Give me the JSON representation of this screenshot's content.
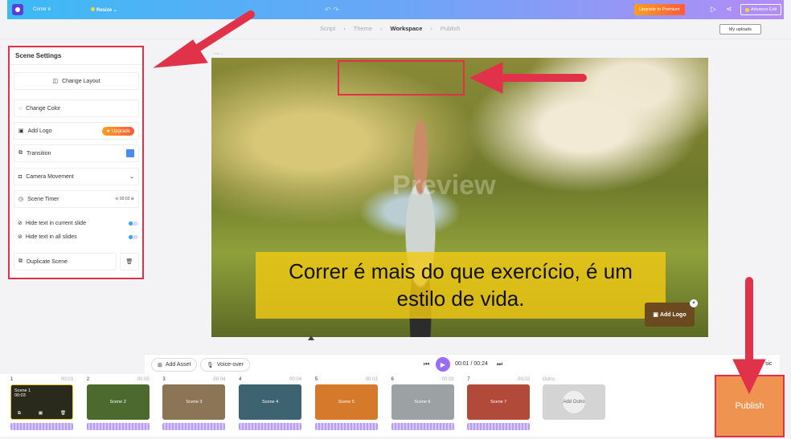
{
  "topbar": {
    "project_title": "Correr é",
    "resize": "Resize",
    "upgrade": "Upgrade to Premium",
    "advance_edit": "Advance Edit"
  },
  "steps": [
    "Script",
    "Theme",
    "Workspace",
    "Publish"
  ],
  "my_uploads": "My uploads",
  "scene_settings": {
    "title": "Scene Settings",
    "change_layout": "Change Layout",
    "change_color": "Change Color",
    "add_logo": "Add Logo",
    "upgrade_badge": "Upgrade",
    "transition": "Transition",
    "camera_movement": "Camera Movement",
    "scene_timer": "Scene Timer",
    "timer_value": "00:03",
    "hide_current": "Hide text in current slide",
    "hide_all": "Hide text in all slides",
    "duplicate": "Duplicate Scene"
  },
  "canvas": {
    "slide_label": "Slide 1",
    "watermark": "Preview",
    "caption": "Correr é mais do que exercício, é um estilo de vida.",
    "add_logo": "Add Logo"
  },
  "controls": {
    "add_asset": "Add Asset",
    "voice_over": "Voice-over",
    "time": "00:01 / 00:24",
    "music": "sic"
  },
  "scenes": [
    {
      "num": "1",
      "dur": "00:03",
      "label": "Scene 1",
      "color": "#2a2a1c"
    },
    {
      "num": "2",
      "dur": "00:05",
      "label": "Scene 2",
      "color": "#4d6a2e"
    },
    {
      "num": "3",
      "dur": "00:04",
      "label": "Scene 3",
      "color": "#8c7556"
    },
    {
      "num": "4",
      "dur": "00:04",
      "label": "Scene 4",
      "color": "#3d6270"
    },
    {
      "num": "5",
      "dur": "00:03",
      "label": "Scene 5",
      "color": "#d47a2a"
    },
    {
      "num": "6",
      "dur": "00:03",
      "label": "Scene 6",
      "color": "#9ca2a4"
    },
    {
      "num": "7",
      "dur": "00:02",
      "label": "Scene 7",
      "color": "#b24a3a"
    }
  ],
  "outro": {
    "num": "Outro",
    "label": "Add Outro"
  },
  "selected_scene_time": "00:03",
  "publish": "Publish"
}
